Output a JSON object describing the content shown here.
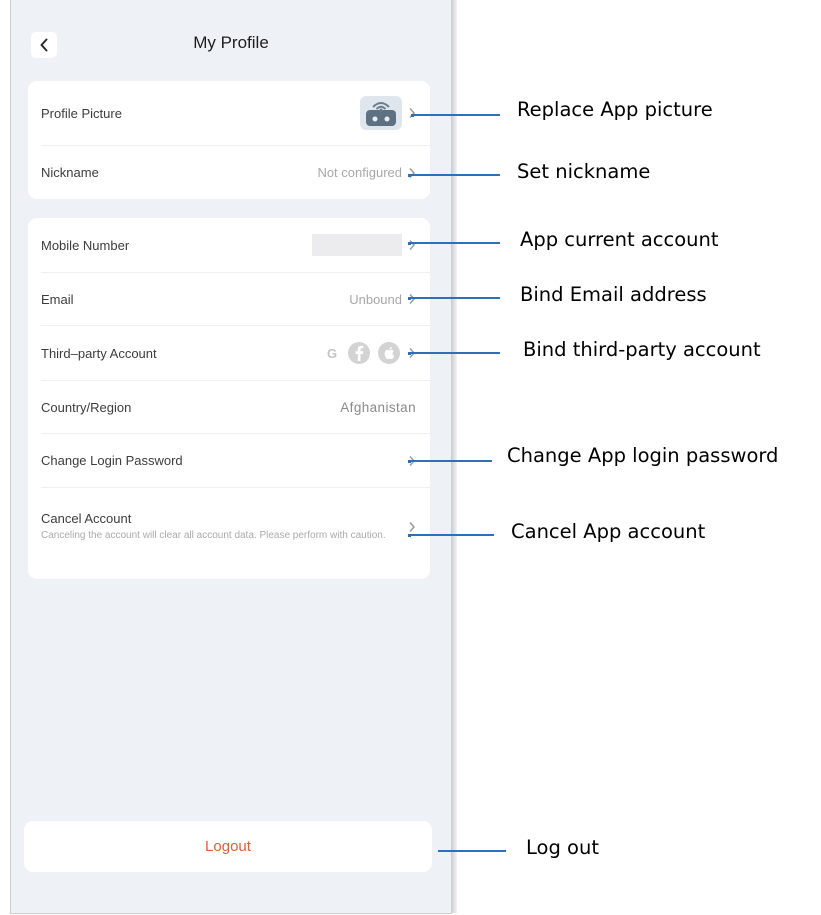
{
  "header": {
    "title": "My Profile",
    "back_icon": "chevron-left-icon"
  },
  "profile_card": {
    "rows": [
      {
        "label": "Profile Picture",
        "value": "",
        "icon": "robot-avatar-icon"
      },
      {
        "label": "Nickname",
        "value": "Not configured"
      }
    ]
  },
  "account_card": {
    "rows": [
      {
        "label": "Mobile Number",
        "value": ""
      },
      {
        "label": "Email",
        "value": "Unbound"
      },
      {
        "label": "Third–party Account",
        "value": "",
        "icons": [
          "google-icon",
          "facebook-icon",
          "apple-icon"
        ],
        "google_glyph": "G"
      },
      {
        "label": "Country/Region",
        "value": "Afghanistan"
      },
      {
        "label": "Change Login Password",
        "value": ""
      },
      {
        "label": "Cancel Account",
        "description": "Canceling the account will clear all account data. Please perform with caution."
      }
    ]
  },
  "logout": {
    "label": "Logout",
    "color": "#d9603b"
  },
  "annotations": [
    {
      "text": "Replace App picture"
    },
    {
      "text": "Set nickname"
    },
    {
      "text": "App current account"
    },
    {
      "text": "Bind Email address"
    },
    {
      "text": "Bind third-party account"
    },
    {
      "text": "Change App login password"
    },
    {
      "text": "Cancel App account"
    },
    {
      "text": "Log out"
    }
  ],
  "colors": {
    "annotation_line": "#2e6fba",
    "background": "#eef1f5",
    "chevron": "#9b9b9b"
  }
}
